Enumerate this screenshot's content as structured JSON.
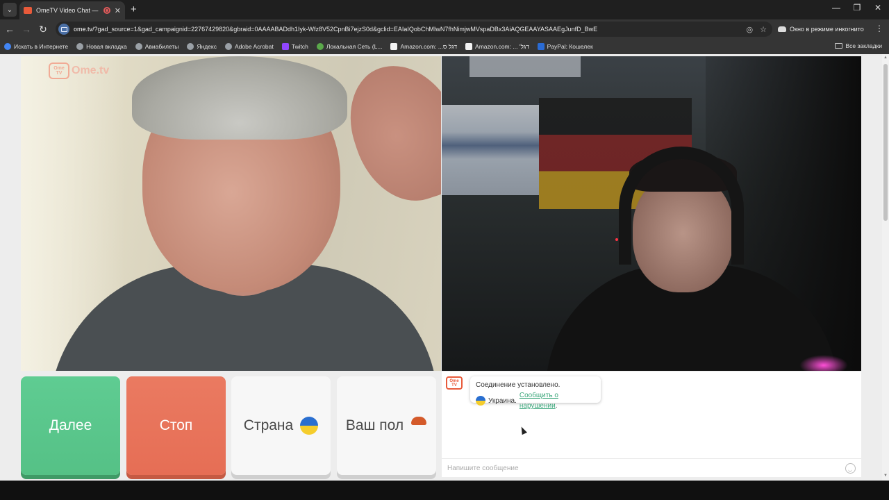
{
  "browser": {
    "tab_title": "OmeTV Video Chat — Omegle",
    "url_host": "ome.tv",
    "url_path": "/?gad_source=1&gad_campaignid=22767429820&gbraid=0AAAABADdh1Iyk-Wfz8V52CpnBi7ejzS0d&gclid=EAIaIQobChMIwN7fhNimjwMVspaDBx3AiAQGEAAYASAAEgJunfD_BwE",
    "incognito_label": "Окно в режиме инкогнито",
    "bookmarks": [
      {
        "label": "Искать в Интернете",
        "icon": "search-globe-icon"
      },
      {
        "label": "Новая вкладка",
        "icon": "globe-icon"
      },
      {
        "label": "Авиабилеты",
        "icon": "globe-icon"
      },
      {
        "label": "Яндекс",
        "icon": "globe-icon"
      },
      {
        "label": "Adobe Acrobat",
        "icon": "globe-icon"
      },
      {
        "label": "Twitch",
        "icon": "twitch-icon"
      },
      {
        "label": "Локальная Сеть (L...",
        "icon": "android-icon"
      },
      {
        "label": "Amazon.com: ...דגל ס",
        "icon": "amazon-icon"
      },
      {
        "label": "Amazon.com: ... 'דגל",
        "icon": "amazon-icon"
      },
      {
        "label": "PayPal: Кошелек",
        "icon": "paypal-icon"
      }
    ],
    "all_bookmarks_label": "Все закладки"
  },
  "app": {
    "logo_text": "Ome.tv",
    "logo_badge": "Ome TV",
    "buttons": {
      "next": "Далее",
      "stop": "Стоп",
      "country": "Страна",
      "gender": "Ваш пол"
    },
    "chat": {
      "connected_message": "Соединение установлено.",
      "country_name": "Украина.",
      "report_link": "Сообщить о нарушении",
      "report_suffix": ".",
      "input_placeholder": "Напишите сообщение"
    }
  },
  "colors": {
    "next": "#5fcc92",
    "stop": "#ea7a61",
    "link": "#3aa67a"
  }
}
